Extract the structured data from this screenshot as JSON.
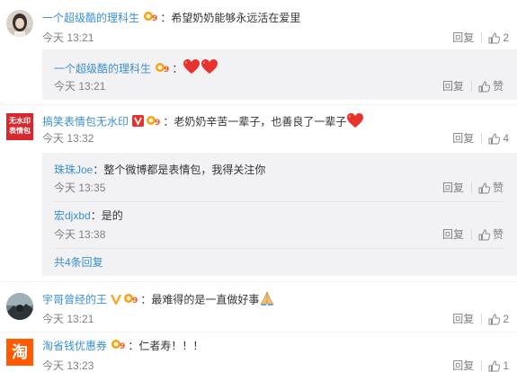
{
  "comments": [
    {
      "user": "一个超级酷的理科生",
      "text": "希望奶奶能够永远活在爱里",
      "time": "今天 13:21",
      "reply_label": "回复",
      "like_count": "2",
      "replies": [
        {
          "user": "一个超级酷的理科生",
          "text": "",
          "time": "今天 13:21",
          "reply_label": "回复",
          "like_label": "赞"
        }
      ]
    },
    {
      "user": "搞笑表情包无水印",
      "text": "老奶奶辛苦一辈子，也善良了一辈子",
      "time": "今天 13:32",
      "reply_label": "回复",
      "like_count": "4",
      "avatar_text_top": "无水印",
      "avatar_text_bottom": "表情包",
      "replies": [
        {
          "user": "珠珠Joe",
          "text": "整个微博都是表情包，我得关注你",
          "time": "今天 13:35",
          "reply_label": "回复",
          "like_label": "赞"
        },
        {
          "user": "宏djxbd",
          "text": "是的",
          "time": "今天 13:38",
          "reply_label": "回复",
          "like_label": "赞"
        }
      ],
      "more_label": "共4条回复"
    },
    {
      "user": "宇哥曾经的王",
      "text": "最难得的是一直做好事",
      "time": "今天 13:21",
      "reply_label": "回复",
      "like_count": "2"
    },
    {
      "user": "淘省钱优惠券",
      "text": "仁者寿！！！",
      "time": "今天 13:23",
      "reply_label": "回复",
      "like_count": "1",
      "avatar_text": "淘"
    }
  ],
  "colors": {
    "username": "#eb7350",
    "link_blue": "#3b8fd1",
    "timestamp": "#808080",
    "reply_bg": "#f2f2f5"
  },
  "icons": [
    "thumbs-up-icon",
    "vip-badge-icon",
    "verified-v-badge-icon",
    "heart-emoji-icon",
    "praying-hands-emoji-icon"
  ]
}
